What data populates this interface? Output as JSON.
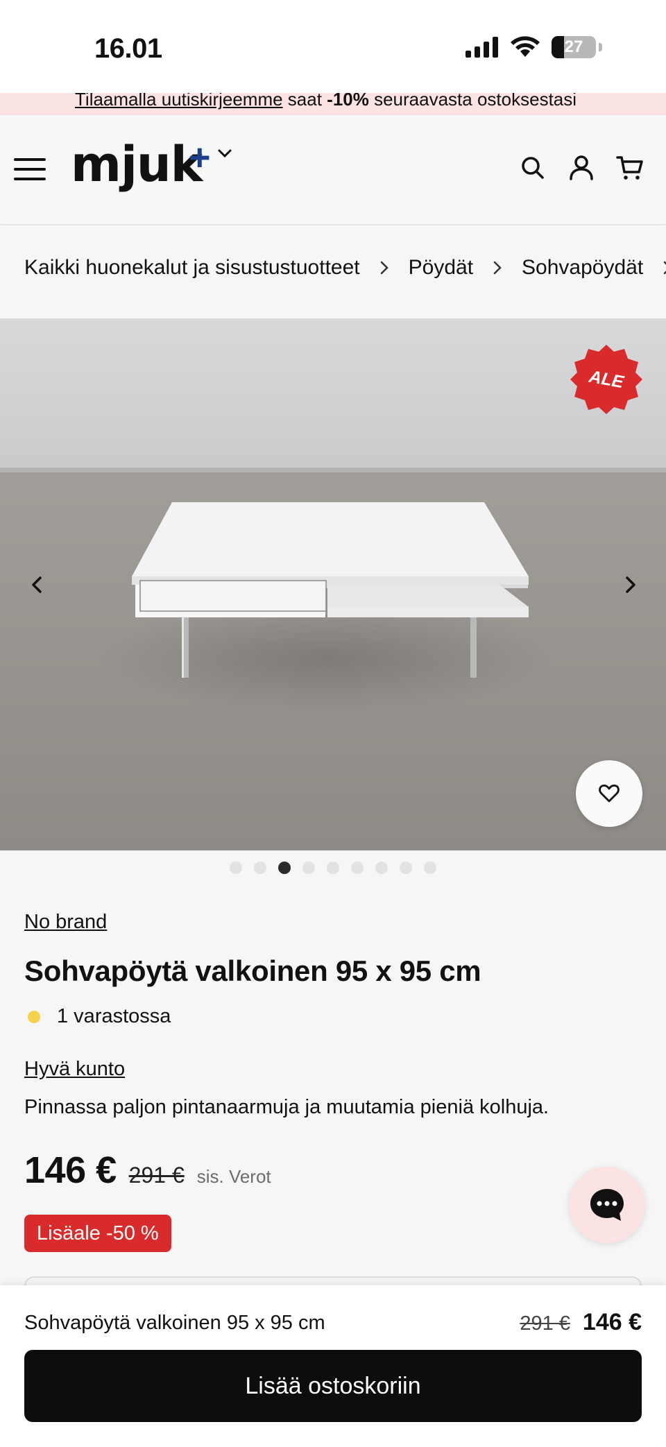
{
  "status_bar": {
    "time": "16.01",
    "battery": "27"
  },
  "promo": {
    "link_text": "Tilaamalla uutiskirjeemme",
    "text_after_link": " saat ",
    "bold": "-10%",
    "text_end": " seuraavasta ostoksestasi"
  },
  "header": {
    "logo": "mjuk",
    "logo_plus": "+"
  },
  "breadcrumb": [
    "Kaikki huonekalut ja sisustustuotteet",
    "Pöydät",
    "Sohvapöydät"
  ],
  "gallery": {
    "badge": "ALE",
    "dot_count": 9,
    "active_dot": 3
  },
  "product": {
    "brand": "No brand",
    "title": "Sohvapöytä valkoinen 95 x 95 cm",
    "stock": "1 varastossa",
    "condition": "Hyvä kunto",
    "condition_description": "Pinnassa paljon pintanaarmuja ja muutamia pieniä kolhuja.",
    "price": "146 €",
    "old_price": "291 €",
    "tax_note": "sis. Verot",
    "discount": "Lisäale -50 %"
  },
  "sticky_bar": {
    "title": "Sohvapöytä valkoinen 95 x 95 cm",
    "old_price": "291 €",
    "price": "146 €",
    "cta": "Lisää ostoskoriin"
  },
  "colors": {
    "sale_red": "#d92b2b",
    "promo_pink": "#fbe3e3",
    "stock_yellow": "#f6d24a",
    "logo_blue": "#1c3f8c"
  }
}
